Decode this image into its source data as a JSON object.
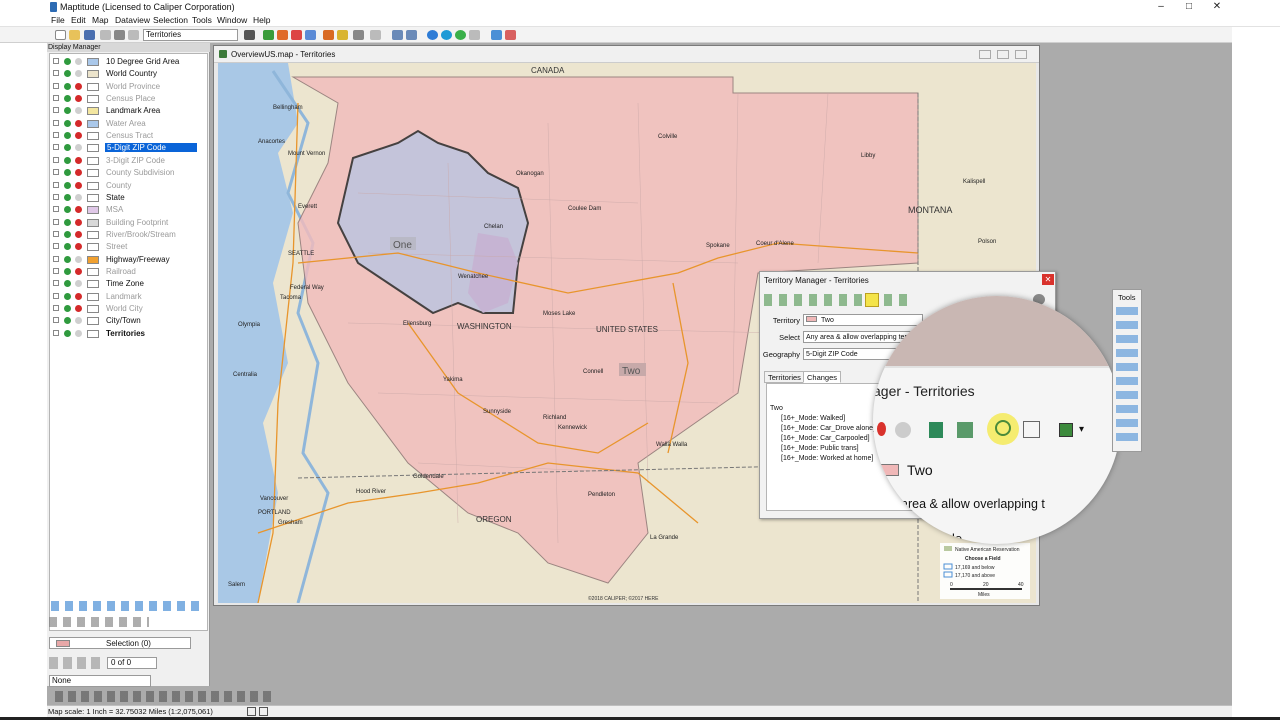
{
  "window": {
    "title": "Maptitude (Licensed to Caliper Corporation)",
    "controls": [
      "–",
      "□",
      "✕"
    ]
  },
  "menu": [
    "File",
    "Edit",
    "Map",
    "Dataview",
    "Selection",
    "Tools",
    "Window",
    "Help"
  ],
  "toolbar": {
    "layer_select": "Territories"
  },
  "display_manager": {
    "header": "Display Manager",
    "layers": [
      {
        "name": "10 Degree Grid Area",
        "visible": true,
        "swatch": "#aac8ea"
      },
      {
        "name": "World Country",
        "visible": true,
        "swatch": "#ece4cc"
      },
      {
        "name": "World Province",
        "visible": false,
        "swatch": "#ffffff"
      },
      {
        "name": "Census Place",
        "visible": false,
        "swatch": "#ffffff"
      },
      {
        "name": "Landmark Area",
        "visible": true,
        "swatch": "#f3e6a0"
      },
      {
        "name": "Water Area",
        "visible": false,
        "swatch": "#aac8ea"
      },
      {
        "name": "Census Tract",
        "visible": false,
        "swatch": "#ffffff"
      },
      {
        "name": "5-Digit ZIP Code",
        "visible": true,
        "selected": true,
        "swatch": "#ffffff"
      },
      {
        "name": "3-Digit ZIP Code",
        "visible": false,
        "swatch": "#ffffff"
      },
      {
        "name": "County Subdivision",
        "visible": false,
        "swatch": "#ffffff"
      },
      {
        "name": "County",
        "visible": false,
        "swatch": "#ffffff"
      },
      {
        "name": "State",
        "visible": true,
        "swatch": "#ffffff"
      },
      {
        "name": "MSA",
        "visible": false,
        "swatch": "#e0c8e8"
      },
      {
        "name": "Building Footprint",
        "visible": false,
        "swatch": "#d8d8d8"
      },
      {
        "name": "River/Brook/Stream",
        "visible": false,
        "swatch": "#ffffff"
      },
      {
        "name": "Street",
        "visible": false,
        "swatch": "#ffffff"
      },
      {
        "name": "Highway/Freeway",
        "visible": true,
        "swatch": "#f0a030"
      },
      {
        "name": "Railroad",
        "visible": false,
        "swatch": "#ffffff"
      },
      {
        "name": "Time Zone",
        "visible": true,
        "swatch": "#ffffff"
      },
      {
        "name": "Landmark",
        "visible": false,
        "swatch": "#ffffff"
      },
      {
        "name": "World City",
        "visible": false,
        "swatch": "#ffffff"
      },
      {
        "name": "City/Town",
        "visible": true,
        "swatch": "#ffffff"
      },
      {
        "name": "Territories",
        "visible": true,
        "bold": true,
        "swatch": "#ffffff"
      }
    ],
    "selection_set": "Selection (0)",
    "page": "0 of 0",
    "none_select": "None"
  },
  "map_window": {
    "title": "OverviewUS.map - Territories",
    "labels": {
      "canada": "CANADA",
      "montana": "MONTANA",
      "washington": "WASHINGTON",
      "oregon": "OREGON",
      "united_states": "UNITED STATES",
      "territory_one": "One",
      "territory_two": "Two"
    },
    "cities": [
      "Bellingham",
      "Anacortes",
      "Mount Vernon",
      "Everett",
      "SEATTLE",
      "Federal Way",
      "Tacoma",
      "Olympia",
      "Centralia",
      "Ellensburg",
      "Wenatchee",
      "Chelan",
      "Okanogan",
      "Colville",
      "Coulee Dam",
      "Spokane",
      "Coeur d'Alene",
      "Moses Lake",
      "Yakima",
      "Sunnyside",
      "Richland",
      "Kennewick",
      "Connell",
      "Walla Walla",
      "Goldendale",
      "Hood River",
      "Vancouver",
      "PORTLAND",
      "Gresham",
      "Salem",
      "Pendleton",
      "La Grande",
      "Libby",
      "Kalispell",
      "Polson"
    ],
    "copyright": "©2018 CALIPER; ©2017 HERE",
    "legend": {
      "items": [
        "Native American Reservation",
        "Choose a Field",
        "17,169 and below",
        "17,170 and above"
      ],
      "scale_ticks": [
        "0",
        "20",
        "40"
      ],
      "scale_unit": "Miles"
    }
  },
  "territory_manager": {
    "title": "Territory Manager - Territories",
    "territory_label": "Territory",
    "territory_value": "Two",
    "select_label": "Select",
    "select_value": "Any area & allow overlapping terr",
    "geography_label": "Geography",
    "geography_value": "5-Digit ZIP Code",
    "tabs": [
      "Territories",
      "Changes"
    ],
    "changes": [
      "Two",
      "[16+_Mode: Walked]",
      "[16+_Mode: Car_Drove alone]",
      "[16+_Mode: Car_Carpooled]",
      "[16+_Mode: Public trans]",
      "[16+_Mode: Worked at home]"
    ]
  },
  "magnifier": {
    "title": "ager - Territories",
    "territory": "Two",
    "select": "area & allow overlapping t",
    "code": "Code"
  },
  "tools_palette": {
    "title": "Tools"
  },
  "status_bar": {
    "scale": "Map scale: 1 Inch = 32.75032 Miles (1:2,075,061)"
  }
}
